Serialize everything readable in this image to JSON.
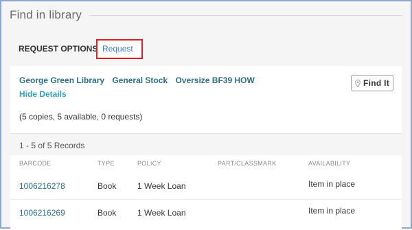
{
  "section": {
    "title": "Find in library"
  },
  "request_options": {
    "label": "REQUEST OPTIONS:",
    "request_link": "Request"
  },
  "holding": {
    "library": "George Green Library",
    "location": "General Stock",
    "call_number": "Oversize BF39 HOW",
    "hide_details": "Hide Details",
    "find_it": "Find It",
    "find_it_icon": "map-pin-icon",
    "copies_summary": "(5 copies, 5 available, 0 requests)"
  },
  "records": {
    "count_text": "1 - 5 of 5 Records",
    "columns": [
      "BARCODE",
      "TYPE",
      "POLICY",
      "PART/CLASSMARK",
      "AVAILABILITY"
    ],
    "rows": [
      {
        "barcode": "1006216278",
        "type": "Book",
        "policy": "1 Week Loan",
        "part": "",
        "availability": "Item in place"
      },
      {
        "barcode": "1006216269",
        "type": "Book",
        "policy": "1 Week Loan",
        "part": "",
        "availability": "Item in place"
      }
    ]
  },
  "colors": {
    "link": "#3a7fc1",
    "holding_link": "#2f6d86",
    "hide_details": "#3aa0b6",
    "highlight": "#e02020",
    "frame": "#8fa6cf"
  }
}
